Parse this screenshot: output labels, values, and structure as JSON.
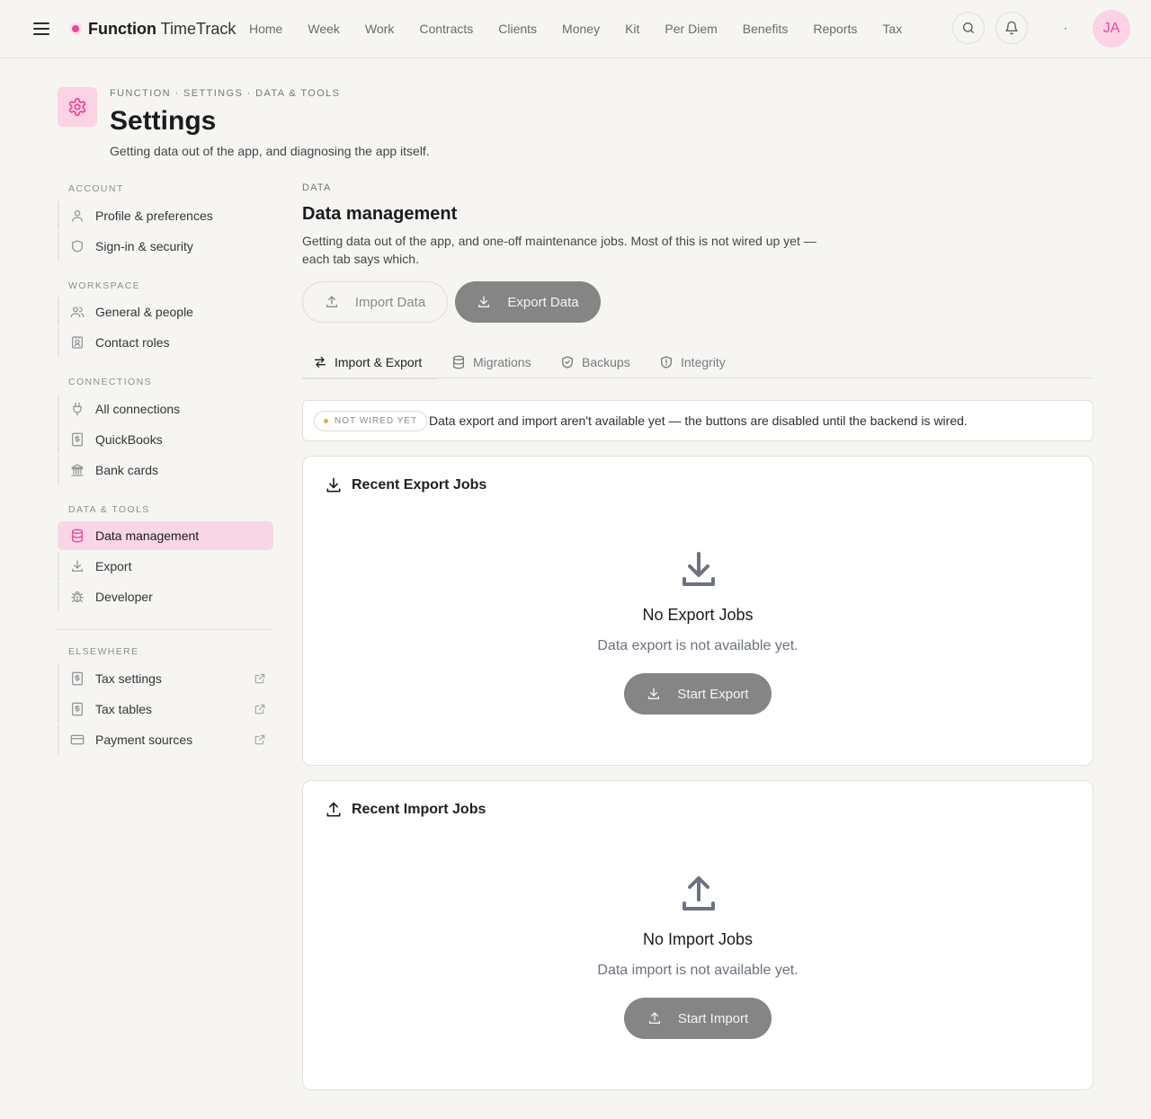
{
  "topnav": {
    "brand_bold": "Function",
    "brand_rest": " TimeTrack",
    "links": [
      "Home",
      "Week",
      "Work",
      "Contracts",
      "Clients",
      "Money",
      "Kit",
      "Per Diem",
      "Benefits",
      "Reports",
      "Tax"
    ],
    "avatar_initials": "JA",
    "icons": [
      "menu-icon",
      "search-icon",
      "bell-icon"
    ]
  },
  "header": {
    "breadcrumb": "FUNCTION · SETTINGS · DATA & TOOLS",
    "title": "Settings",
    "subtitle": "Getting data out of the app, and diagnosing the app itself."
  },
  "sidebar": {
    "groups": [
      {
        "label": "ACCOUNT",
        "items": [
          {
            "label": "Profile & preferences",
            "icon": "user-icon"
          },
          {
            "label": "Sign-in & security",
            "icon": "shield-icon"
          }
        ]
      },
      {
        "label": "WORKSPACE",
        "items": [
          {
            "label": "General & people",
            "icon": "users-icon"
          },
          {
            "label": "Contact roles",
            "icon": "contact-badge-icon"
          }
        ]
      },
      {
        "label": "CONNECTIONS",
        "items": [
          {
            "label": "All connections",
            "icon": "plug-icon"
          },
          {
            "label": "QuickBooks",
            "icon": "receipt-icon"
          },
          {
            "label": "Bank cards",
            "icon": "bank-icon"
          }
        ]
      },
      {
        "label": "DATA & TOOLS",
        "items": [
          {
            "label": "Data management",
            "icon": "database-icon",
            "active": true
          },
          {
            "label": "Export",
            "icon": "download-icon"
          },
          {
            "label": "Developer",
            "icon": "bug-icon"
          }
        ]
      },
      {
        "label": "ELSEWHERE",
        "items": [
          {
            "label": "Tax settings",
            "icon": "receipt-icon",
            "external": true
          },
          {
            "label": "Tax tables",
            "icon": "receipt-icon",
            "external": true
          },
          {
            "label": "Payment sources",
            "icon": "credit-card-icon",
            "external": true
          }
        ]
      }
    ]
  },
  "main": {
    "eyebrow": "DATA",
    "title": "Data management",
    "description": "Getting data out of the app, and one-off maintenance jobs. Most of this is not wired up yet — each tab says which.",
    "import_button": "Import Data",
    "export_button": "Export Data",
    "tabs": [
      {
        "label": "Import & Export",
        "active": true
      },
      {
        "label": "Migrations"
      },
      {
        "label": "Backups"
      },
      {
        "label": "Integrity"
      }
    ],
    "notice": {
      "badge": "NOT WIRED YET",
      "text": "Data export and import aren't available yet — the buttons are disabled until the backend is wired."
    },
    "export_card": {
      "title": "Recent Export Jobs",
      "empty_title": "No Export Jobs",
      "empty_desc": "Data export is not available yet.",
      "button": "Start Export"
    },
    "import_card": {
      "title": "Recent Import Jobs",
      "empty_title": "No Import Jobs",
      "empty_desc": "Data import is not available yet.",
      "button": "Start Import"
    }
  },
  "colors": {
    "accent": "#ec4899",
    "accent_soft": "#fbd3e4",
    "disabled_button": "#858585",
    "background": "#f6f5f2"
  }
}
